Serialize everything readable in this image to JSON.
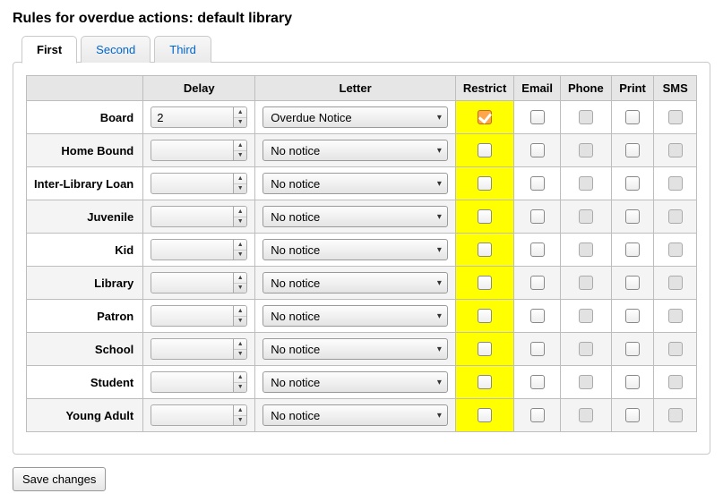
{
  "title": "Rules for overdue actions: default library",
  "tabs": [
    {
      "label": "First",
      "active": true
    },
    {
      "label": "Second",
      "active": false
    },
    {
      "label": "Third",
      "active": false
    }
  ],
  "columns": {
    "delay": "Delay",
    "letter": "Letter",
    "restrict": "Restrict",
    "email": "Email",
    "phone": "Phone",
    "print": "Print",
    "sms": "SMS"
  },
  "rows": [
    {
      "name": "Board",
      "delay": "2",
      "letter": "Overdue Notice",
      "restrict": true,
      "email": false,
      "phone": false,
      "print": false,
      "sms": false,
      "phone_disabled": true,
      "sms_disabled": true
    },
    {
      "name": "Home Bound",
      "delay": "",
      "letter": "No notice",
      "restrict": false,
      "email": false,
      "phone": false,
      "print": false,
      "sms": false,
      "phone_disabled": true,
      "sms_disabled": true
    },
    {
      "name": "Inter-Library Loan",
      "delay": "",
      "letter": "No notice",
      "restrict": false,
      "email": false,
      "phone": false,
      "print": false,
      "sms": false,
      "phone_disabled": true,
      "sms_disabled": true
    },
    {
      "name": "Juvenile",
      "delay": "",
      "letter": "No notice",
      "restrict": false,
      "email": false,
      "phone": false,
      "print": false,
      "sms": false,
      "phone_disabled": true,
      "sms_disabled": true
    },
    {
      "name": "Kid",
      "delay": "",
      "letter": "No notice",
      "restrict": false,
      "email": false,
      "phone": false,
      "print": false,
      "sms": false,
      "phone_disabled": true,
      "sms_disabled": true
    },
    {
      "name": "Library",
      "delay": "",
      "letter": "No notice",
      "restrict": false,
      "email": false,
      "phone": false,
      "print": false,
      "sms": false,
      "phone_disabled": true,
      "sms_disabled": true
    },
    {
      "name": "Patron",
      "delay": "",
      "letter": "No notice",
      "restrict": false,
      "email": false,
      "phone": false,
      "print": false,
      "sms": false,
      "phone_disabled": true,
      "sms_disabled": true
    },
    {
      "name": "School",
      "delay": "",
      "letter": "No notice",
      "restrict": false,
      "email": false,
      "phone": false,
      "print": false,
      "sms": false,
      "phone_disabled": true,
      "sms_disabled": true
    },
    {
      "name": "Student",
      "delay": "",
      "letter": "No notice",
      "restrict": false,
      "email": false,
      "phone": false,
      "print": false,
      "sms": false,
      "phone_disabled": true,
      "sms_disabled": true
    },
    {
      "name": "Young Adult",
      "delay": "",
      "letter": "No notice",
      "restrict": false,
      "email": false,
      "phone": false,
      "print": false,
      "sms": false,
      "phone_disabled": true,
      "sms_disabled": true
    }
  ],
  "buttons": {
    "save": "Save changes"
  }
}
